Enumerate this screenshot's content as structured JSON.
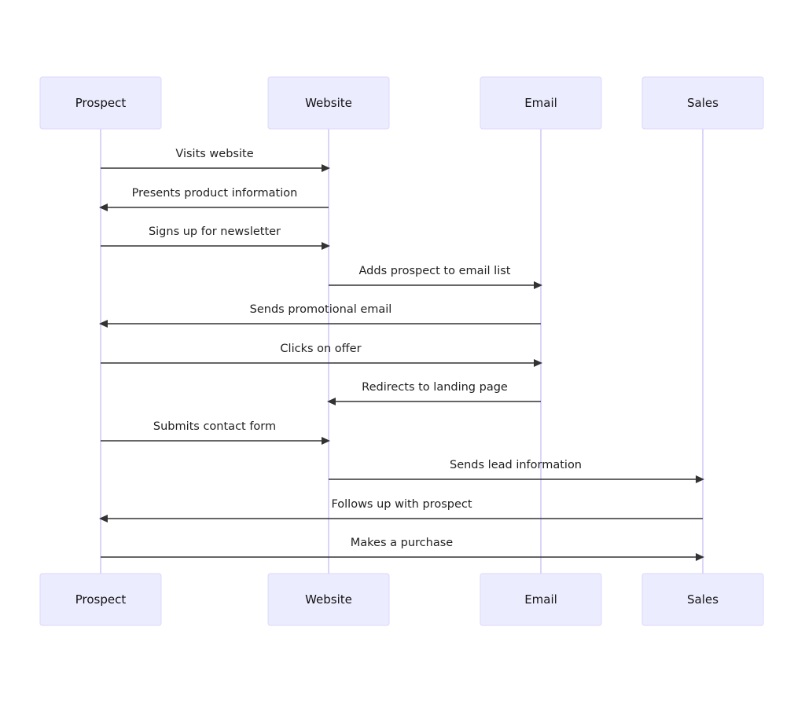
{
  "diagram": {
    "type": "sequence",
    "actors": [
      {
        "id": "prospect",
        "label": "Prospect"
      },
      {
        "id": "website",
        "label": "Website"
      },
      {
        "id": "email",
        "label": "Email"
      },
      {
        "id": "sales",
        "label": "Sales"
      }
    ],
    "messages": [
      {
        "from": "prospect",
        "to": "website",
        "label": "Visits website"
      },
      {
        "from": "website",
        "to": "prospect",
        "label": "Presents product information"
      },
      {
        "from": "prospect",
        "to": "website",
        "label": "Signs up for newsletter"
      },
      {
        "from": "website",
        "to": "email",
        "label": "Adds prospect to email list"
      },
      {
        "from": "email",
        "to": "prospect",
        "label": "Sends promotional email"
      },
      {
        "from": "prospect",
        "to": "email",
        "label": "Clicks on offer"
      },
      {
        "from": "email",
        "to": "website",
        "label": "Redirects to landing page"
      },
      {
        "from": "prospect",
        "to": "website",
        "label": "Submits contact form"
      },
      {
        "from": "website",
        "to": "sales",
        "label": "Sends lead information"
      },
      {
        "from": "sales",
        "to": "prospect",
        "label": "Follows up with prospect"
      },
      {
        "from": "prospect",
        "to": "sales",
        "label": "Makes a purchase"
      }
    ]
  }
}
